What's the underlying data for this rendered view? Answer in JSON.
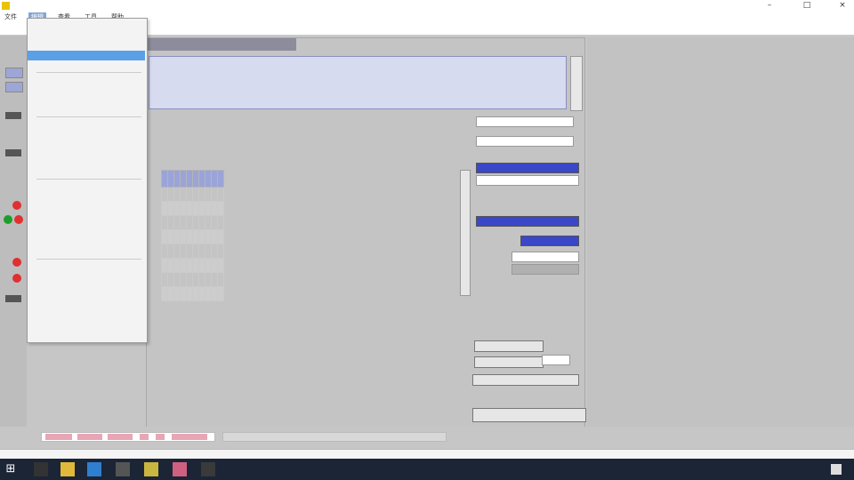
{
  "window": {
    "title": "",
    "controls": [
      "–",
      "□",
      "×"
    ]
  },
  "menubar": {
    "items": [
      "文件",
      "编辑",
      "查看",
      "工具",
      "帮助"
    ],
    "active_index": 1
  },
  "dropdown": {
    "items": [
      {
        "label": "",
        "shortcut": ""
      },
      {
        "label": "",
        "shortcut": "",
        "selected": true
      }
    ]
  },
  "panel": {
    "header": "",
    "title": "",
    "notes": ""
  },
  "table": {
    "headers": [
      "",
      "",
      "",
      "",
      "",
      "",
      "",
      "",
      "",
      ""
    ],
    "rows": [
      [
        "",
        "",
        "",
        "",
        "",
        "",
        "",
        "",
        "",
        ""
      ],
      [
        "",
        "",
        "",
        "",
        "",
        "",
        "",
        "",
        "",
        ""
      ],
      [
        "",
        "",
        "",
        "",
        "",
        "",
        "",
        "",
        "",
        ""
      ],
      [
        "",
        "",
        "",
        "",
        "",
        "",
        "",
        "",
        "",
        ""
      ],
      [
        "",
        "",
        "",
        "",
        "",
        "",
        "",
        "",
        "",
        ""
      ],
      [
        "",
        "",
        "",
        "",
        "",
        "",
        "",
        "",
        "",
        ""
      ],
      [
        "",
        "",
        "",
        "",
        "",
        "",
        "",
        "",
        "",
        ""
      ],
      [
        "",
        "",
        "",
        "",
        "",
        "",
        "",
        "",
        "",
        ""
      ]
    ]
  },
  "colors": {
    "accent_blue": "#3a47c8",
    "header_blue": "#9aa4d8",
    "selection": "#5ba0e4",
    "alert_red": "#e03030",
    "ok_green": "#1aa02a",
    "taskbar": "#1b2536"
  },
  "icons": {
    "start": "windows-start-icon",
    "close": "close-icon",
    "minimize": "minimize-icon",
    "maximize": "maximize-icon"
  }
}
